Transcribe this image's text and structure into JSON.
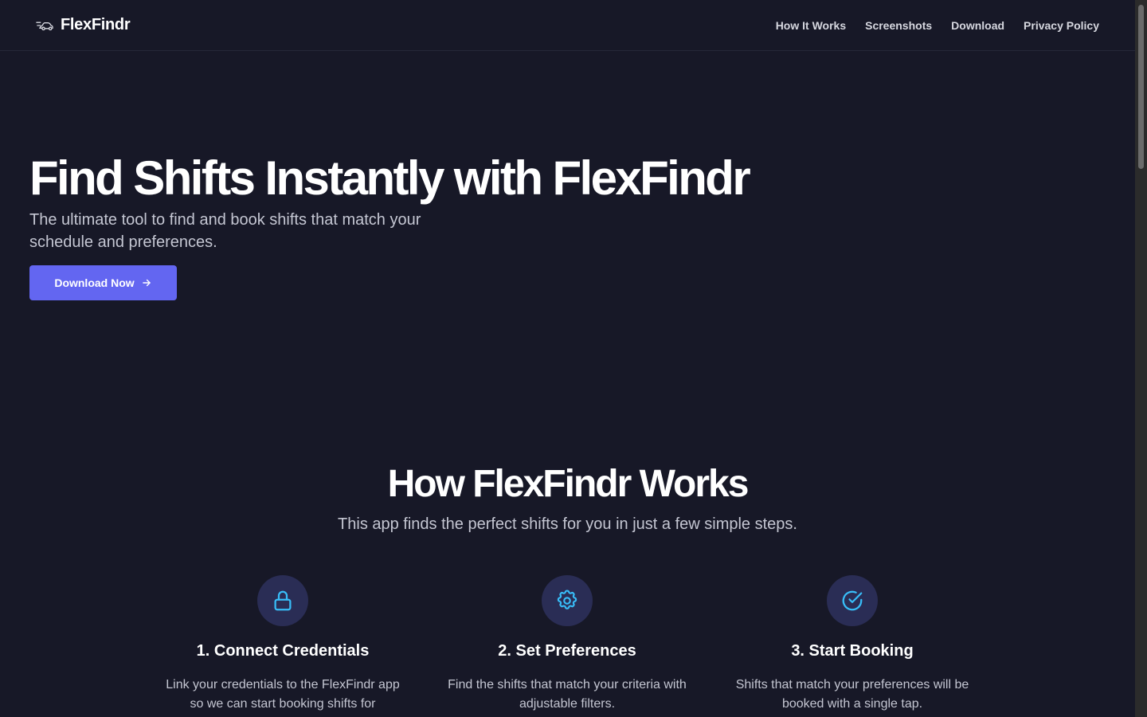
{
  "header": {
    "brand_name": "FlexFindr",
    "brand_icon": "car-icon",
    "nav": [
      {
        "label": "How It Works"
      },
      {
        "label": "Screenshots"
      },
      {
        "label": "Download"
      },
      {
        "label": "Privacy Policy"
      }
    ]
  },
  "hero": {
    "title": "Find Shifts Instantly with FlexFindr",
    "subtitle": "The ultimate tool to find and book shifts that match your schedule and preferences.",
    "cta_label": "Download Now",
    "cta_icon": "arrow-right-icon"
  },
  "how_it_works": {
    "title": "How FlexFindr Works",
    "subtitle": "This app finds the perfect shifts for you in just a few simple steps.",
    "steps": [
      {
        "icon": "lock-icon",
        "title": "1. Connect Credentials",
        "description": "Link your credentials to the FlexFindr app so we can start booking shifts for"
      },
      {
        "icon": "gear-icon",
        "title": "2. Set Preferences",
        "description": "Find the shifts that match your criteria with adjustable filters."
      },
      {
        "icon": "check-circle-icon",
        "title": "3. Start Booking",
        "description": "Shifts that match your preferences will be booked with a single tap."
      }
    ]
  },
  "colors": {
    "background": "#171827",
    "accent": "#6366f1",
    "icon_accent": "#38bdf8",
    "icon_circle": "#2a2d55"
  }
}
